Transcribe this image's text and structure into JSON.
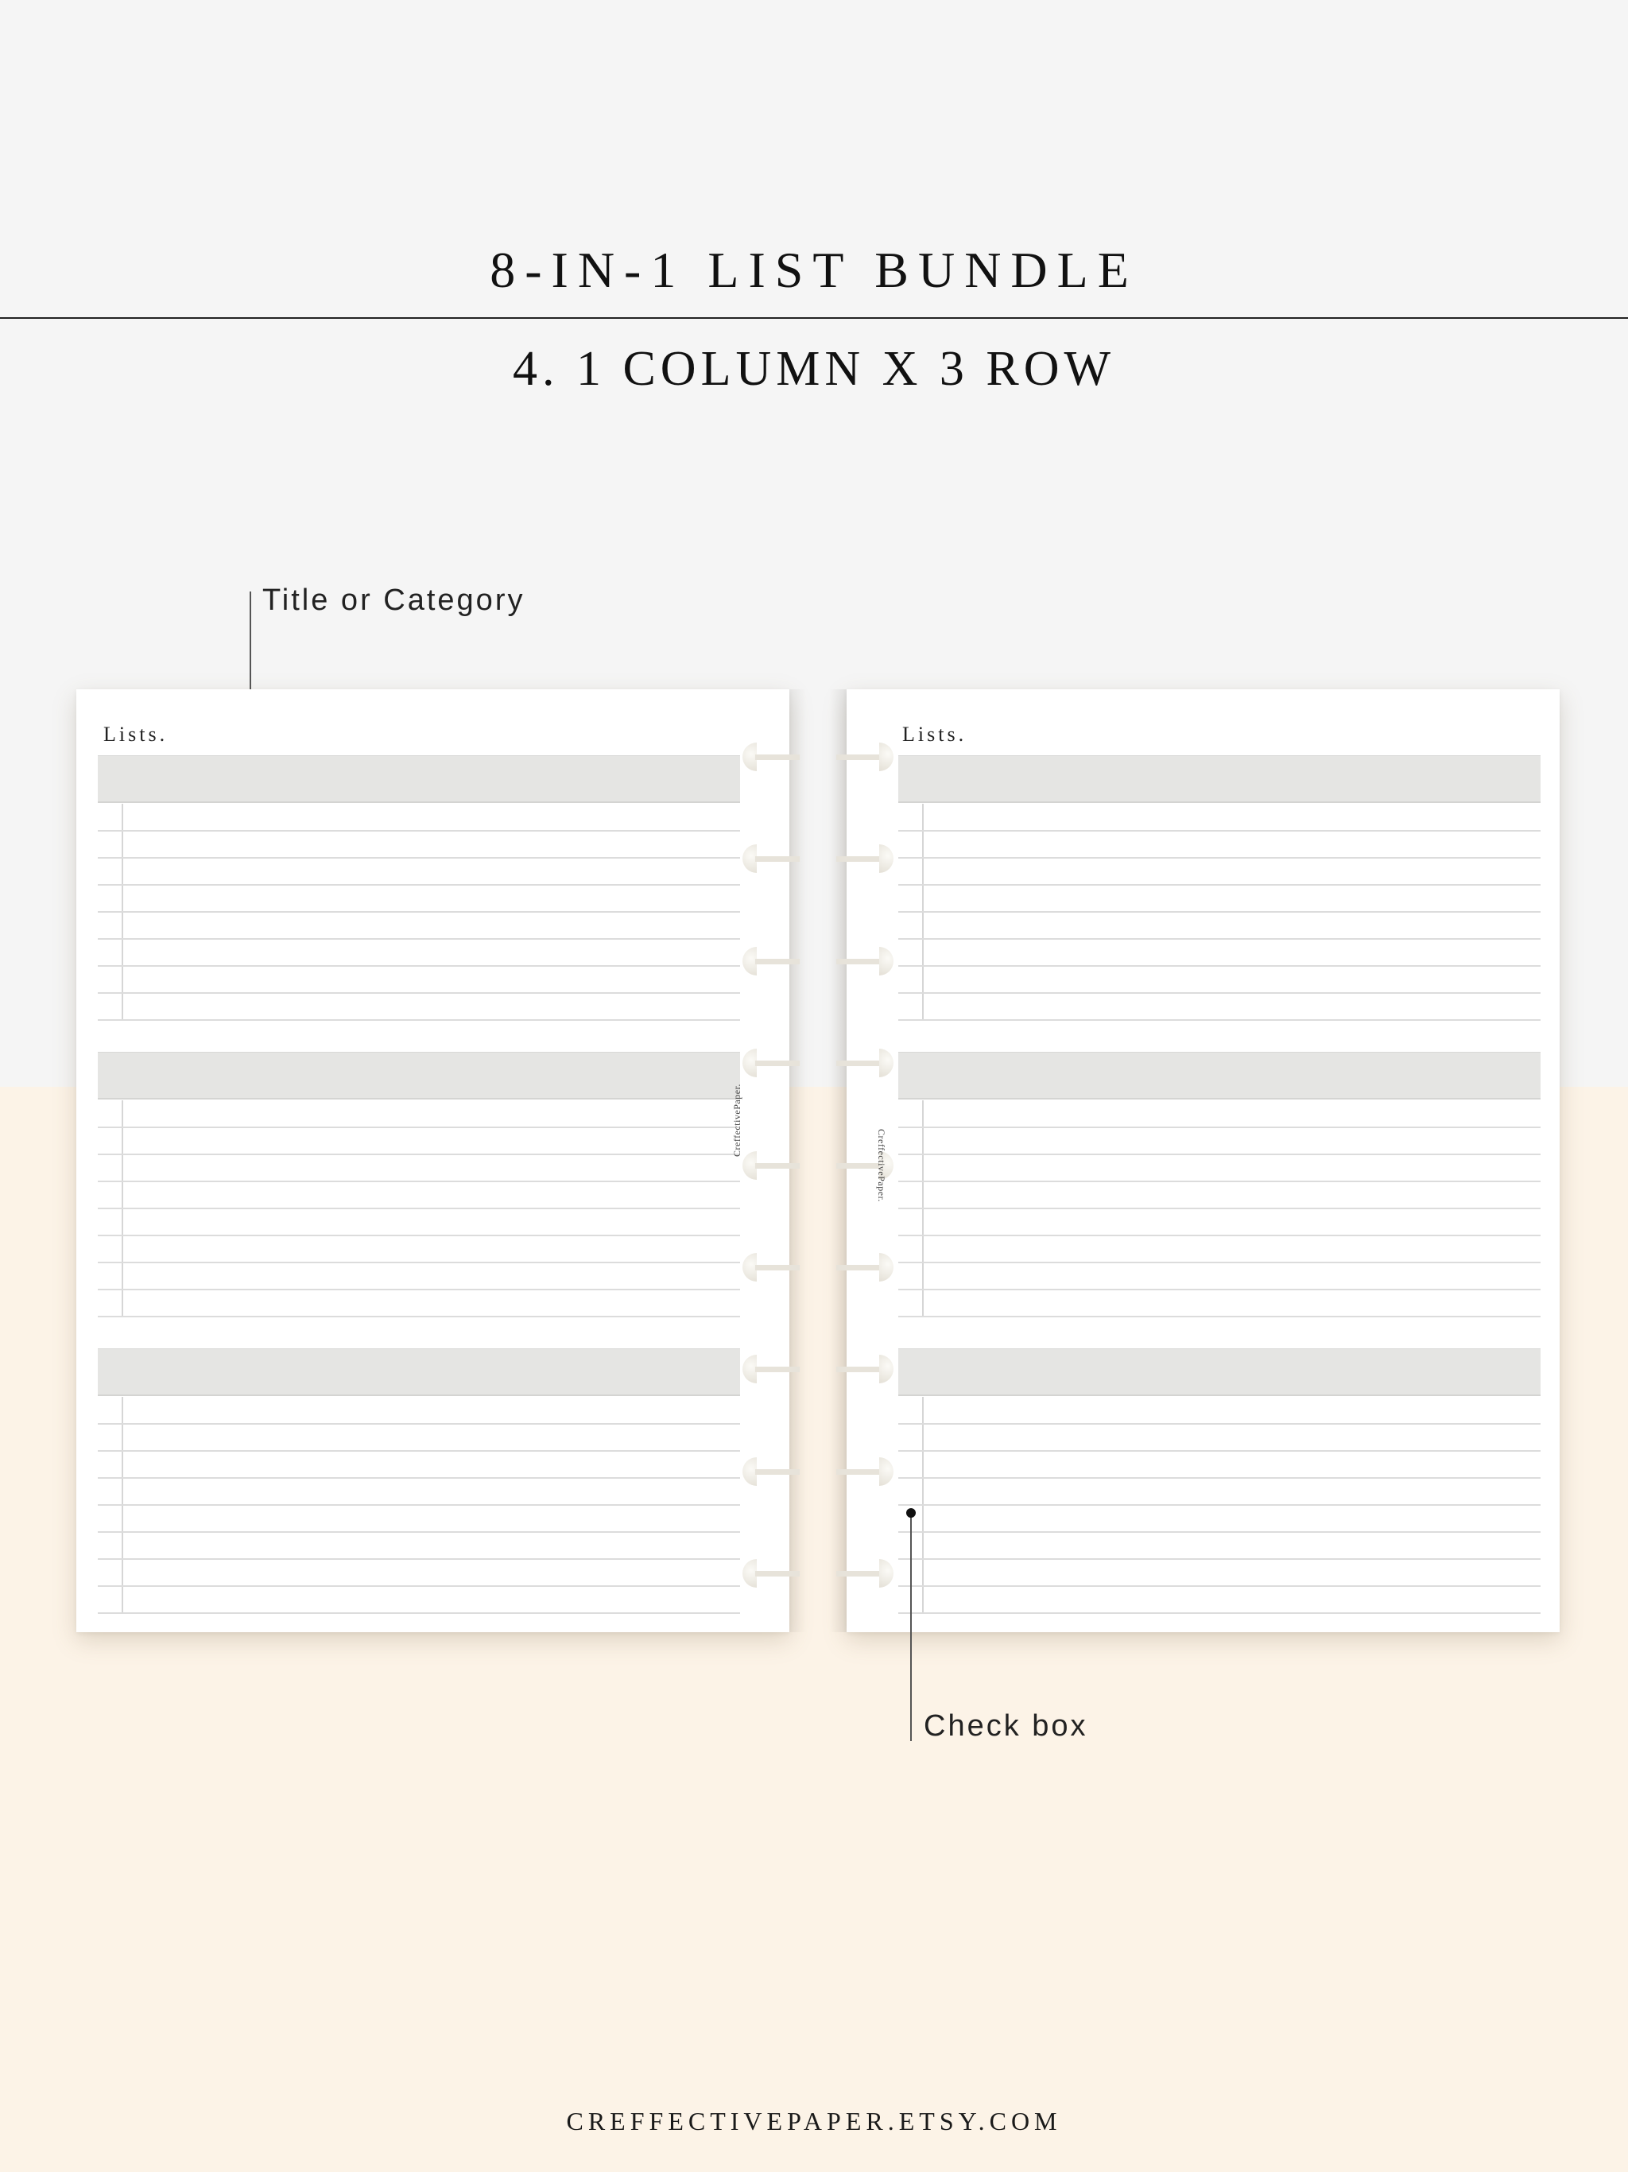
{
  "header": {
    "title": "8-IN-1 LIST BUNDLE",
    "subtitle": "4. 1 COLUMN X 3 ROW"
  },
  "callouts": {
    "title_or_category": "Title or Category",
    "check_box": "Check box"
  },
  "pages": [
    {
      "side": "left",
      "title": "Lists.",
      "sections": 3,
      "lines_per_section": 8,
      "spine_text": "CreffectivePaper."
    },
    {
      "side": "right",
      "title": "Lists.",
      "sections": 3,
      "lines_per_section": 8,
      "spine_text": "CreffectivePaper."
    }
  ],
  "binding": {
    "ring_count": 9
  },
  "footer": {
    "shop_url": "CREFFECTIVEPAPER.ETSY.COM"
  },
  "colors": {
    "top_background": "#f5f5f5",
    "bottom_background": "#fcf3e7",
    "header_bar": "#e5e5e3",
    "rule_line": "#dcdcdc",
    "text": "#111111"
  }
}
